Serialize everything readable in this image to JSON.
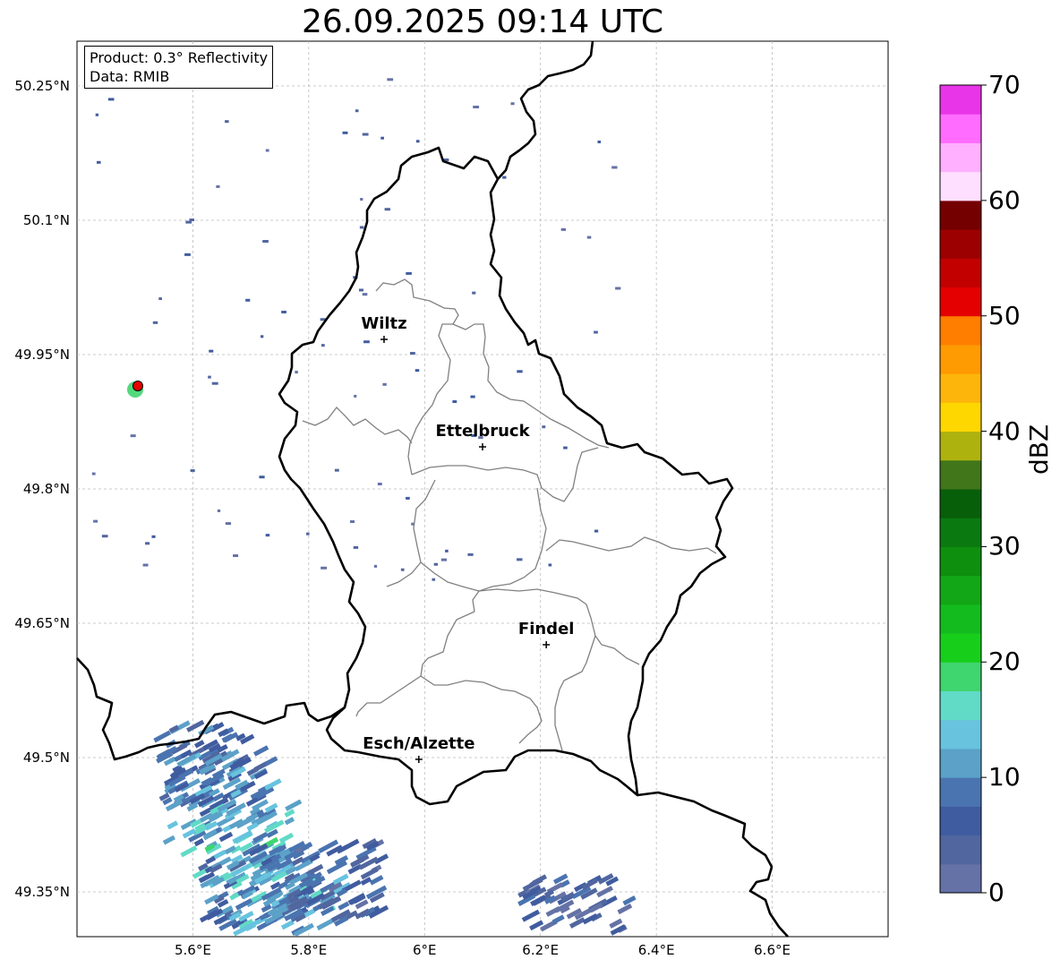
{
  "title": "26.09.2025 09:14 UTC",
  "info": {
    "product": "Product: 0.3° Reflectivity",
    "data": "Data: RMIB"
  },
  "map_extent": {
    "lon_min": 5.4,
    "lon_max": 6.8,
    "lat_min": 49.3,
    "lat_max": 50.3
  },
  "lat_ticks": [
    {
      "value": 50.25,
      "label": "50.25°N"
    },
    {
      "value": 50.1,
      "label": "50.1°N"
    },
    {
      "value": 49.95,
      "label": "49.95°N"
    },
    {
      "value": 49.8,
      "label": "49.8°N"
    },
    {
      "value": 49.65,
      "label": "49.65°N"
    },
    {
      "value": 49.5,
      "label": "49.5°N"
    },
    {
      "value": 49.35,
      "label": "49.35°N"
    }
  ],
  "lon_ticks": [
    {
      "value": 5.6,
      "label": "5.6°E"
    },
    {
      "value": 5.8,
      "label": "5.8°E"
    },
    {
      "value": 6.0,
      "label": "6°E"
    },
    {
      "value": 6.2,
      "label": "6.2°E"
    },
    {
      "value": 6.4,
      "label": "6.4°E"
    },
    {
      "value": 6.6,
      "label": "6.6°E"
    }
  ],
  "cities": [
    {
      "name": "Wiltz",
      "lon": 5.93,
      "lat": 49.967
    },
    {
      "name": "Ettelbruck",
      "lon": 6.1,
      "lat": 49.847
    },
    {
      "name": "Findel",
      "lon": 6.21,
      "lat": 49.626
    },
    {
      "name": "Esch/Alzette",
      "lon": 5.99,
      "lat": 49.498
    }
  ],
  "radar_site": {
    "lon": 5.505,
    "lat": 49.915,
    "color": "#e60000"
  },
  "colorbar": {
    "label": "dBZ",
    "min": 0,
    "max": 70,
    "ticks": [
      "0",
      "10",
      "20",
      "30",
      "40",
      "50",
      "60",
      "70"
    ],
    "colors": [
      "#6572a6",
      "#51669f",
      "#405ca0",
      "#4a74b0",
      "#5ba1c8",
      "#67c3de",
      "#61dac6",
      "#3fd56f",
      "#17cf1b",
      "#13bb1f",
      "#12a716",
      "#0e8f0e",
      "#0a7a10",
      "#085f0a",
      "#41761a",
      "#aeb20f",
      "#ffd700",
      "#fdb50b",
      "#fe9a02",
      "#ff7e00",
      "#e40000",
      "#c20000",
      "#9c0000",
      "#740000",
      "#ffdfff",
      "#ffb0ff",
      "#ff6cff",
      "#e935e8"
    ]
  },
  "echo_clusters": [
    {
      "lon": 5.62,
      "lat": 49.49,
      "dbz": 8
    },
    {
      "lon": 5.64,
      "lat": 49.45,
      "dbz": 10
    },
    {
      "lon": 5.67,
      "lat": 49.4,
      "dbz": 14
    },
    {
      "lon": 5.7,
      "lat": 49.35,
      "dbz": 8
    },
    {
      "lon": 5.75,
      "lat": 49.32,
      "dbz": 12
    },
    {
      "lon": 5.82,
      "lat": 49.36,
      "dbz": 6
    },
    {
      "lon": 6.25,
      "lat": 49.32,
      "dbz": 4
    }
  ]
}
